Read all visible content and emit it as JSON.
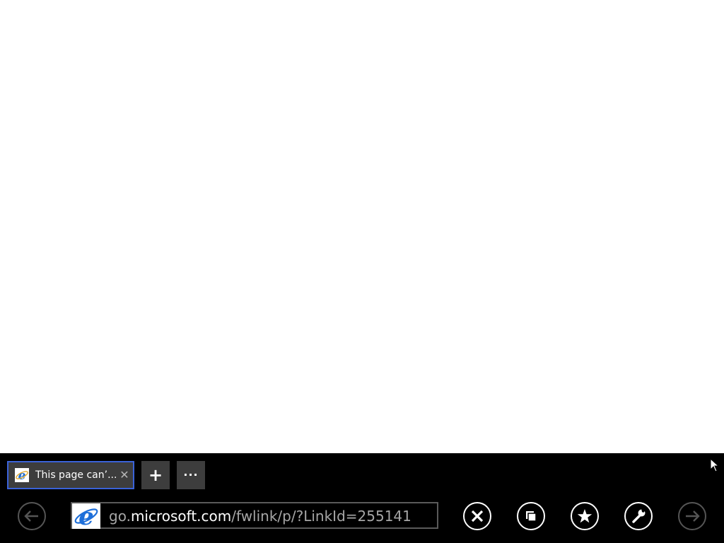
{
  "tab": {
    "title": "This page can’...",
    "close_glyph": "✕",
    "favicon": "ie-logo-icon"
  },
  "tab_actions": {
    "new_tab_glyph": "+",
    "more_glyph": "···"
  },
  "address": {
    "url_prefix": "go.",
    "url_domain": "microsoft.com",
    "url_path": "/fwlink/p/?LinkId=255141",
    "site_icon": "ie-logo-icon"
  },
  "nav": {
    "back": {
      "icon": "back-arrow-icon",
      "enabled": false
    },
    "forward": {
      "icon": "forward-arrow-icon",
      "enabled": false
    }
  },
  "toolbar": {
    "stop": {
      "icon": "close-icon"
    },
    "pin": {
      "icon": "pin-icon"
    },
    "favorites": {
      "icon": "star-icon"
    },
    "tools": {
      "icon": "wrench-icon"
    }
  },
  "colors": {
    "app_bar_bg": "#000000",
    "tab_bg": "#3d3d3d",
    "active_tab_border": "#3a62d8",
    "url_dim": "#a6a6a6",
    "url_bright": "#ffffff",
    "ie_blue": "#1e6fd9"
  }
}
